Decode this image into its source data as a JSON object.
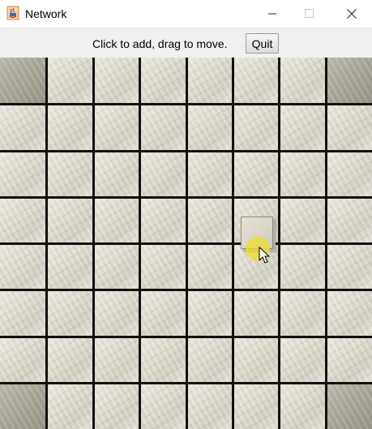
{
  "window": {
    "title": "Network",
    "icon": "java-cup-icon"
  },
  "toolbar": {
    "instructions": "Click to add, drag to move.",
    "quit_label": "Quit"
  },
  "board": {
    "rows": 8,
    "columns": 8,
    "corner_cells": [
      "top-left",
      "top-right",
      "bottom-left",
      "bottom-right"
    ],
    "node": {
      "row": 3,
      "column": 6
    }
  },
  "colors": {
    "cell": "#dedbcb",
    "corner_cell": "#a9a796",
    "grid_lines": "#111111",
    "cursor_highlight": "#f0dc28"
  }
}
